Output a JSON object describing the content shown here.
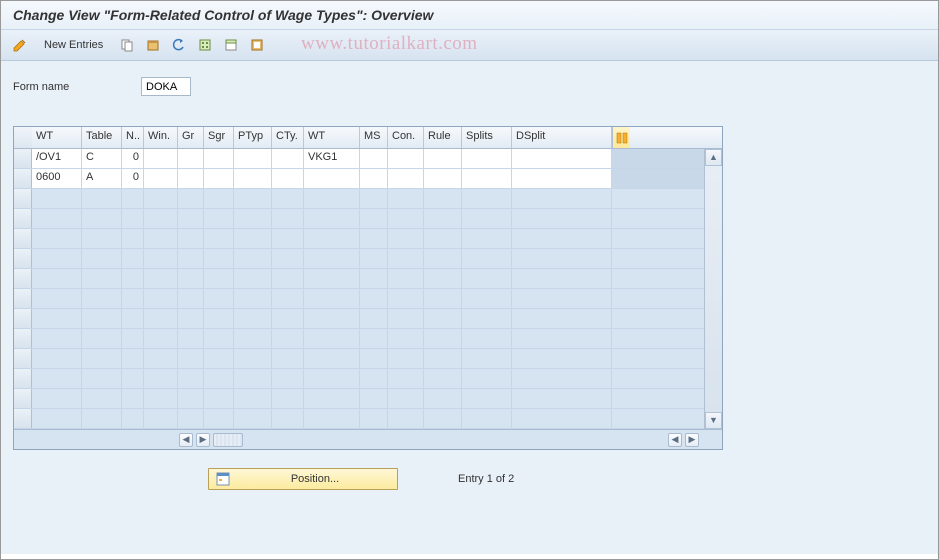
{
  "title": "Change View \"Form-Related Control of Wage Types\": Overview",
  "watermark": "www.tutorialkart.com",
  "toolbar": {
    "new_entries_label": "New Entries"
  },
  "form": {
    "name_label": "Form name",
    "name_value": "DOKA"
  },
  "grid": {
    "columns": [
      "WT",
      "Table",
      "N..",
      "Win.",
      "Gr",
      "Sgr",
      "PTyp",
      "CTy.",
      "WT",
      "MS",
      "Con.",
      "Rule",
      "Splits",
      "DSplit"
    ],
    "rows": [
      {
        "wt1": "/OV1",
        "table": "C",
        "n": "0",
        "win": "",
        "gr": "",
        "sgr": "",
        "ptyp": "",
        "cty": "",
        "wt2": "VKG1",
        "ms": "",
        "con": "",
        "rule": "",
        "splits": "",
        "dsplit": ""
      },
      {
        "wt1": "0600",
        "table": "A",
        "n": "0",
        "win": "",
        "gr": "",
        "sgr": "",
        "ptyp": "",
        "cty": "",
        "wt2": "",
        "ms": "",
        "con": "",
        "rule": "",
        "splits": "",
        "dsplit": ""
      }
    ]
  },
  "position_btn_label": "Position...",
  "entry_text": "Entry 1 of 2"
}
